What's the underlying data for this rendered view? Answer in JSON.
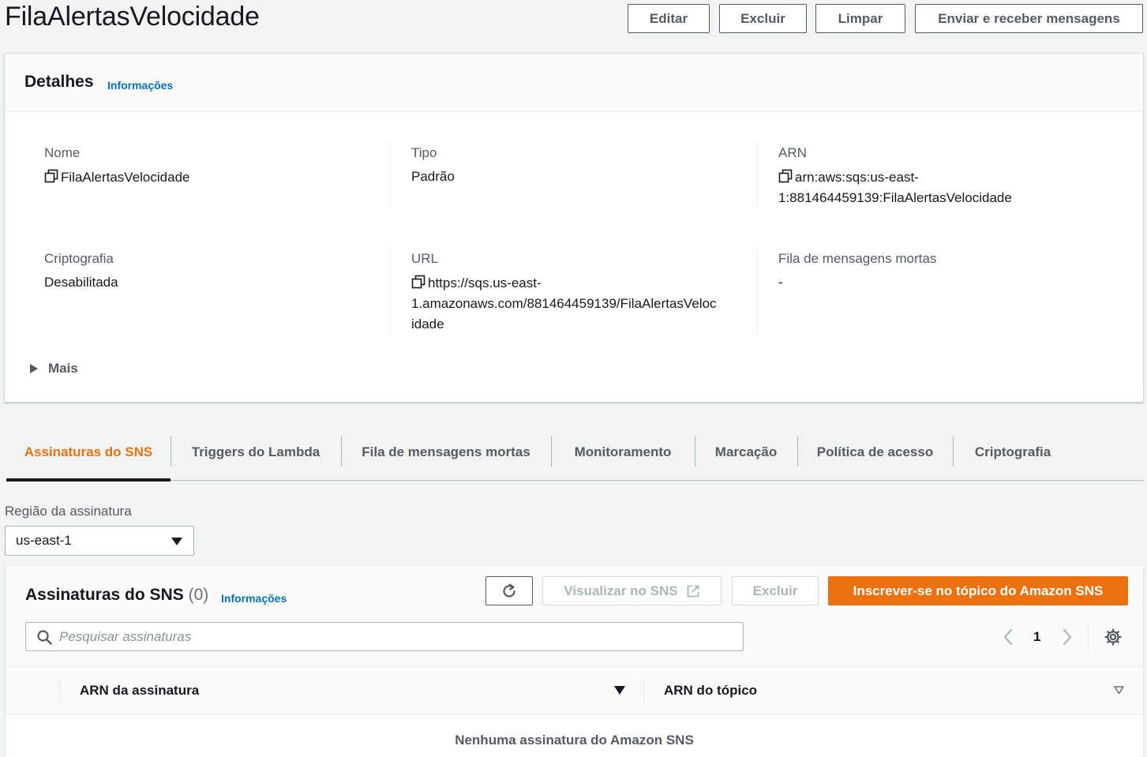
{
  "header": {
    "title": "FilaAlertasVelocidade",
    "buttons": {
      "edit": "Editar",
      "delete": "Excluir",
      "purge": "Limpar",
      "send_receive": "Enviar e receber mensagens"
    }
  },
  "details": {
    "title": "Detalhes",
    "info_link": "Informações",
    "fields": {
      "name": {
        "label": "Nome",
        "value": "FilaAlertasVelocidade"
      },
      "type": {
        "label": "Tipo",
        "value": "Padrão"
      },
      "arn": {
        "label": "ARN",
        "line1": "arn:aws:sqs:us-east-",
        "line2": "1:881464459139:FilaAlertasVelocidade"
      },
      "encryption": {
        "label": "Criptografia",
        "value": "Desabilitada"
      },
      "url": {
        "label": "URL",
        "line1": "https://sqs.us-east-",
        "line2": "1.amazonaws.com/881464459139/FilaAlertasVeloc",
        "line3": "idade"
      },
      "dlq": {
        "label": "Fila de mensagens mortas",
        "value": "-"
      }
    },
    "more_label": "Mais"
  },
  "tabs": [
    {
      "label": "Assinaturas do SNS",
      "active": true
    },
    {
      "label": "Triggers do Lambda"
    },
    {
      "label": "Fila de mensagens mortas"
    },
    {
      "label": "Monitoramento"
    },
    {
      "label": "Marcação"
    },
    {
      "label": "Política de acesso"
    },
    {
      "label": "Criptografia"
    }
  ],
  "region": {
    "label": "Região da assinatura",
    "selected": "us-east-1"
  },
  "sns": {
    "title": "Assinaturas do SNS",
    "count": "(0)",
    "info_link": "Informações",
    "view_in_sns": "Visualizar no SNS",
    "delete": "Excluir",
    "subscribe": "Inscrever-se no tópico do Amazon SNS",
    "search_placeholder": "Pesquisar assinaturas",
    "page": "1",
    "columns": {
      "subscription_arn": "ARN da assinatura",
      "topic_arn": "ARN do tópico"
    },
    "empty_message": "Nenhuma assinatura do Amazon SNS"
  },
  "colors": {
    "accent": "#ec7211",
    "link": "#0073bb",
    "text": "#16191f",
    "muted": "#545b64"
  }
}
